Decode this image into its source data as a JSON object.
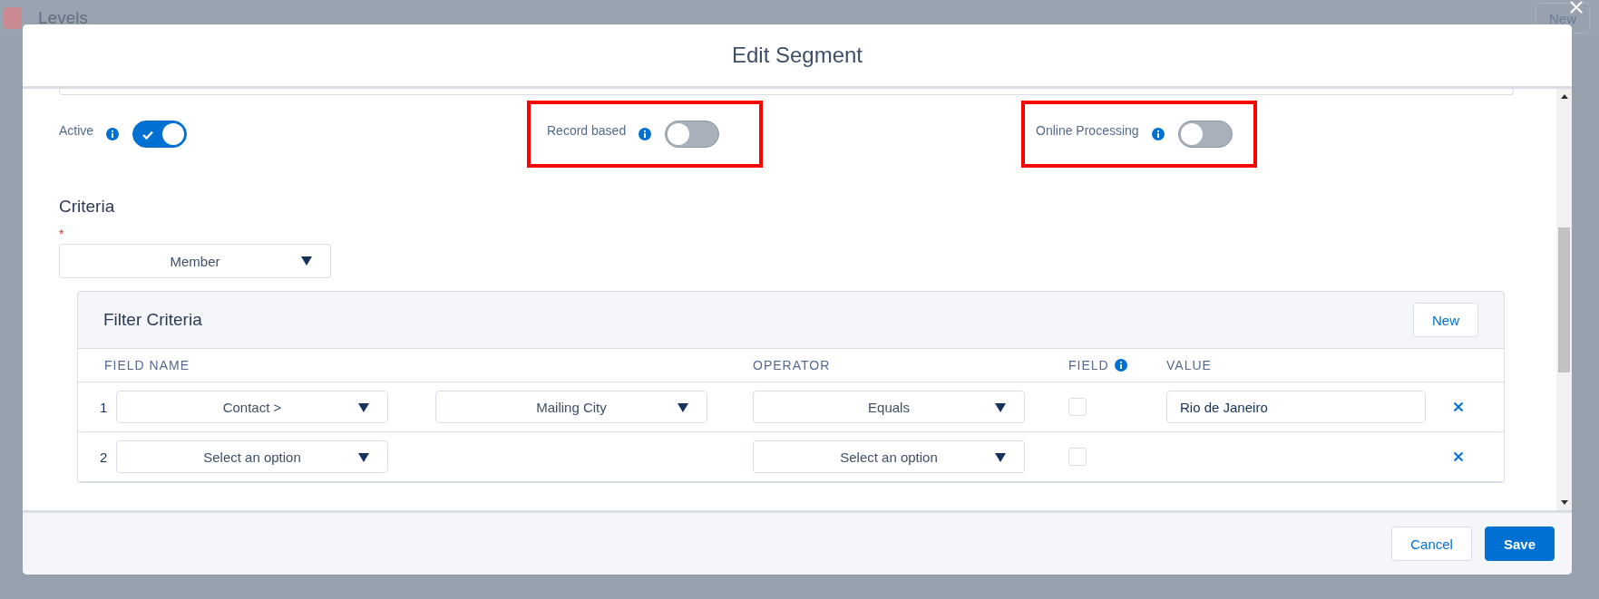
{
  "background": {
    "title": "Levels",
    "new_button": "New"
  },
  "modal": {
    "title": "Edit Segment"
  },
  "toggles": [
    {
      "label": "Active",
      "on": true,
      "highlighted": false
    },
    {
      "label": "Record based",
      "on": false,
      "highlighted": true
    },
    {
      "label": "Online Processing",
      "on": false,
      "highlighted": true
    }
  ],
  "criteria": {
    "title": "Criteria",
    "required_mark": "*",
    "object_select": "Member"
  },
  "filter": {
    "title": "Filter Criteria",
    "new_button": "New",
    "columns": [
      {
        "label": "FIELD NAME",
        "kind": "plain"
      },
      {
        "label": "OPERATOR",
        "kind": "plain"
      },
      {
        "label": "FIELD",
        "kind": "info"
      },
      {
        "label": "VALUE",
        "kind": "plain"
      }
    ],
    "rows": [
      {
        "number": "1",
        "field": "Contact >",
        "subfield": "Mailing City",
        "operator": "Equals",
        "field_checked": false,
        "value": "Rio de Janeiro"
      },
      {
        "number": "2",
        "field": "Select an option",
        "operator": "Select an option",
        "field_checked": false
      }
    ]
  },
  "footer": {
    "cancel": "Cancel",
    "save": "Save"
  }
}
